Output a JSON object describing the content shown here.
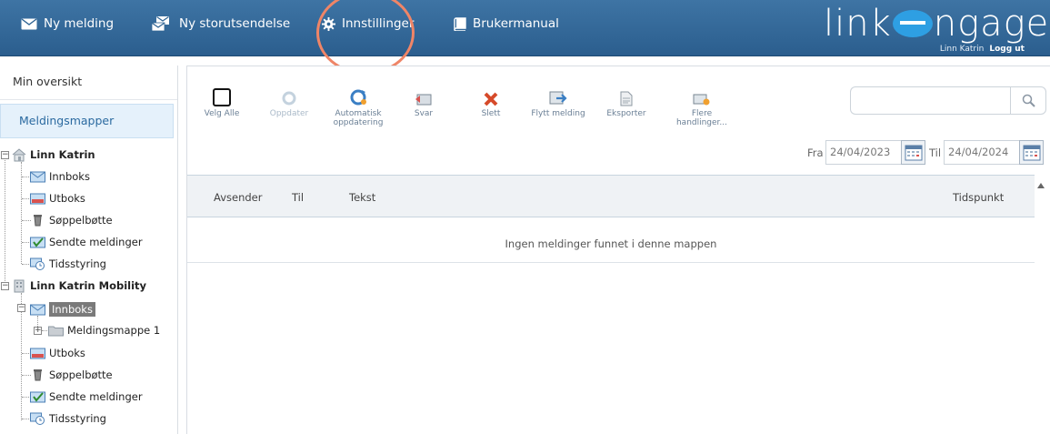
{
  "header": {
    "nav": [
      {
        "label": "Ny melding",
        "icon": "envelope-icon"
      },
      {
        "label": "Ny storutsendelse",
        "icon": "mass-mail-icon"
      },
      {
        "label": "Innstillinger",
        "icon": "gear-icon"
      },
      {
        "label": "Brukermanual",
        "icon": "book-icon"
      }
    ],
    "logo": {
      "prefix": "link",
      "suffix": "ngage"
    },
    "user_name": "Linn Katrin",
    "logout_label": "Logg ut",
    "bar_color": "#2f6494"
  },
  "sidebar": {
    "overview_label": "Min oversikt",
    "folders_label": "Meldingsmapper",
    "accounts": [
      {
        "name": "Linn Katrin",
        "icon": "house-icon",
        "folders": [
          {
            "label": "Innboks",
            "icon": "inbox-icon"
          },
          {
            "label": "Utboks",
            "icon": "outbox-icon"
          },
          {
            "label": "Søppelbøtte",
            "icon": "trash-icon"
          },
          {
            "label": "Sendte meldinger",
            "icon": "sent-icon"
          },
          {
            "label": "Tidsstyring",
            "icon": "schedule-icon"
          }
        ]
      },
      {
        "name": "Linn Katrin Mobility",
        "icon": "building-icon",
        "folders": [
          {
            "label": "Innboks",
            "icon": "inbox-icon",
            "selected": true,
            "children": [
              {
                "label": "Meldingsmappe 1",
                "icon": "folder-icon"
              }
            ]
          },
          {
            "label": "Utboks",
            "icon": "outbox-icon"
          },
          {
            "label": "Søppelbøtte",
            "icon": "trash-icon"
          },
          {
            "label": "Sendte meldinger",
            "icon": "sent-icon"
          },
          {
            "label": "Tidsstyring",
            "icon": "schedule-icon"
          }
        ]
      }
    ]
  },
  "toolbar": {
    "select_all": "Velg Alle",
    "update": "Oppdater",
    "auto_update": "Automatisk oppdatering",
    "reply": "Svar",
    "delete": "Slett",
    "move": "Flytt melding",
    "export": "Eksporter",
    "more": "Flere handlinger..."
  },
  "filter": {
    "from_label": "Fra",
    "from_value": "24/04/2023",
    "to_label": "Til",
    "to_value": "24/04/2024",
    "search_value": ""
  },
  "grid": {
    "columns": [
      "Avsender",
      "Til",
      "Tekst",
      "Tidspunkt"
    ],
    "empty_text": "Ingen meldinger funnet i denne mappen"
  }
}
